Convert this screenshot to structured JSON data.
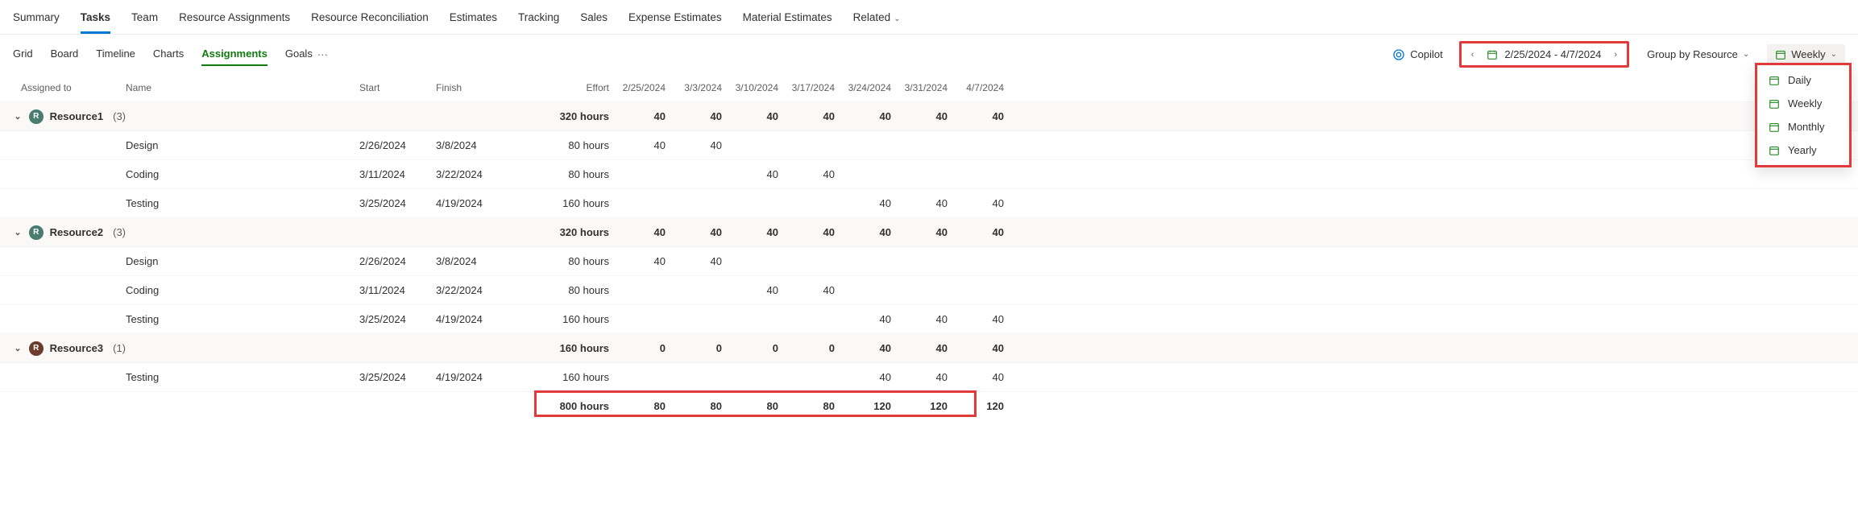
{
  "topTabs": [
    {
      "label": "Summary",
      "active": false
    },
    {
      "label": "Tasks",
      "active": true
    },
    {
      "label": "Team",
      "active": false
    },
    {
      "label": "Resource Assignments",
      "active": false
    },
    {
      "label": "Resource Reconciliation",
      "active": false
    },
    {
      "label": "Estimates",
      "active": false
    },
    {
      "label": "Tracking",
      "active": false
    },
    {
      "label": "Sales",
      "active": false
    },
    {
      "label": "Expense Estimates",
      "active": false
    },
    {
      "label": "Material Estimates",
      "active": false
    },
    {
      "label": "Related",
      "active": false,
      "hasChevron": true
    }
  ],
  "subTabs": [
    {
      "label": "Grid",
      "active": false
    },
    {
      "label": "Board",
      "active": false
    },
    {
      "label": "Timeline",
      "active": false
    },
    {
      "label": "Charts",
      "active": false
    },
    {
      "label": "Assignments",
      "active": true
    },
    {
      "label": "Goals",
      "active": false
    }
  ],
  "copilotLabel": "Copilot",
  "dateRange": "2/25/2024 - 4/7/2024",
  "groupByLabel": "Group by Resource",
  "periodLabel": "Weekly",
  "periodOptions": [
    "Daily",
    "Weekly",
    "Monthly",
    "Yearly"
  ],
  "columns": {
    "assignedTo": "Assigned to",
    "name": "Name",
    "start": "Start",
    "finish": "Finish",
    "effort": "Effort",
    "dates": [
      "2/25/2024",
      "3/3/2024",
      "3/10/2024",
      "3/17/2024",
      "3/24/2024",
      "3/31/2024",
      "4/7/2024"
    ]
  },
  "rows": [
    {
      "type": "group",
      "avatar": "a1",
      "avatarText": "R",
      "resource": "Resource1",
      "count": "(3)",
      "effort": "320 hours",
      "cells": [
        "40",
        "40",
        "40",
        "40",
        "40",
        "40",
        "40"
      ]
    },
    {
      "type": "child",
      "name": "Design",
      "start": "2/26/2024",
      "finish": "3/8/2024",
      "effort": "80 hours",
      "cells": [
        "40",
        "40",
        "",
        "",
        "",
        "",
        ""
      ]
    },
    {
      "type": "child",
      "name": "Coding",
      "start": "3/11/2024",
      "finish": "3/22/2024",
      "effort": "80 hours",
      "cells": [
        "",
        "",
        "40",
        "40",
        "",
        "",
        ""
      ]
    },
    {
      "type": "child",
      "name": "Testing",
      "start": "3/25/2024",
      "finish": "4/19/2024",
      "effort": "160 hours",
      "cells": [
        "",
        "",
        "",
        "",
        "40",
        "40",
        "40"
      ]
    },
    {
      "type": "group",
      "avatar": "a2",
      "avatarText": "R",
      "resource": "Resource2",
      "count": "(3)",
      "effort": "320 hours",
      "cells": [
        "40",
        "40",
        "40",
        "40",
        "40",
        "40",
        "40"
      ]
    },
    {
      "type": "child",
      "name": "Design",
      "start": "2/26/2024",
      "finish": "3/8/2024",
      "effort": "80 hours",
      "cells": [
        "40",
        "40",
        "",
        "",
        "",
        "",
        ""
      ]
    },
    {
      "type": "child",
      "name": "Coding",
      "start": "3/11/2024",
      "finish": "3/22/2024",
      "effort": "80 hours",
      "cells": [
        "",
        "",
        "40",
        "40",
        "",
        "",
        ""
      ]
    },
    {
      "type": "child",
      "name": "Testing",
      "start": "3/25/2024",
      "finish": "4/19/2024",
      "effort": "160 hours",
      "cells": [
        "",
        "",
        "",
        "",
        "40",
        "40",
        "40"
      ]
    },
    {
      "type": "group",
      "avatar": "a3",
      "avatarText": "R",
      "resource": "Resource3",
      "count": "(1)",
      "effort": "160 hours",
      "cells": [
        "0",
        "0",
        "0",
        "0",
        "40",
        "40",
        "40"
      ]
    },
    {
      "type": "child",
      "name": "Testing",
      "start": "3/25/2024",
      "finish": "4/19/2024",
      "effort": "160 hours",
      "cells": [
        "",
        "",
        "",
        "",
        "40",
        "40",
        "40"
      ]
    },
    {
      "type": "total",
      "effort": "800 hours",
      "cells": [
        "80",
        "80",
        "80",
        "80",
        "120",
        "120",
        "120"
      ]
    }
  ]
}
